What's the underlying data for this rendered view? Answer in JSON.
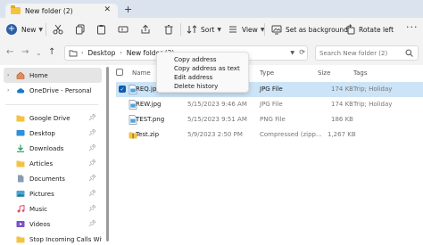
{
  "window": {
    "tab_title": "New folder (2)",
    "close_glyph": "✕",
    "add_tab_glyph": "+"
  },
  "toolbar": {
    "new_label": "New",
    "sort_label": "Sort",
    "view_label": "View",
    "set_background_label": "Set as background",
    "rotate_left_label": "Rotate left",
    "more_glyph": "···"
  },
  "address": {
    "crumbs": [
      "Desktop",
      "New folder (2)"
    ],
    "search_placeholder": "Search New folder (2)"
  },
  "sidebar": {
    "items": [
      {
        "label": "Home",
        "icon": "home-icon"
      },
      {
        "label": "OneDrive - Personal",
        "icon": "cloud-icon"
      },
      {
        "label": "Google Drive",
        "icon": "folder-icon"
      },
      {
        "label": "Desktop",
        "icon": "desktop-icon"
      },
      {
        "label": "Downloads",
        "icon": "download-icon"
      },
      {
        "label": "Articles",
        "icon": "folder-icon"
      },
      {
        "label": "Documents",
        "icon": "documents-icon"
      },
      {
        "label": "Pictures",
        "icon": "pictures-icon"
      },
      {
        "label": "Music",
        "icon": "music-icon"
      },
      {
        "label": "Videos",
        "icon": "videos-icon"
      },
      {
        "label": "Stop Incoming Calls Withou",
        "icon": "folder-icon"
      }
    ]
  },
  "columns": {
    "name": "Name",
    "type": "Type",
    "size": "Size",
    "tags": "Tags"
  },
  "files": [
    {
      "name": "REQ.jpg",
      "date": "",
      "type": "JPG File",
      "size": "174 KB",
      "tags": "Trip; Holiday",
      "icon": "image-file-icon"
    },
    {
      "name": "REW.jpg",
      "date": "5/15/2023 9:46 AM",
      "type": "JPG File",
      "size": "174 KB",
      "tags": "Trip; Holiday",
      "icon": "image-file-icon"
    },
    {
      "name": "TEST.png",
      "date": "5/15/2023 9:51 AM",
      "type": "PNG File",
      "size": "186 KB",
      "tags": "",
      "icon": "image-file-icon"
    },
    {
      "name": "Test.zip",
      "date": "5/9/2023 2:50 PM",
      "type": "Compressed (zipp...",
      "size": "1,267 KB",
      "tags": "",
      "icon": "zip-folder-icon"
    }
  ],
  "context_menu": {
    "items": [
      "Copy address",
      "Copy address as text",
      "Edit address",
      "Delete history"
    ]
  },
  "colors": {
    "accent": "#0b5cad",
    "selected_row": "#cce4f7",
    "folder": "#f5c342"
  }
}
